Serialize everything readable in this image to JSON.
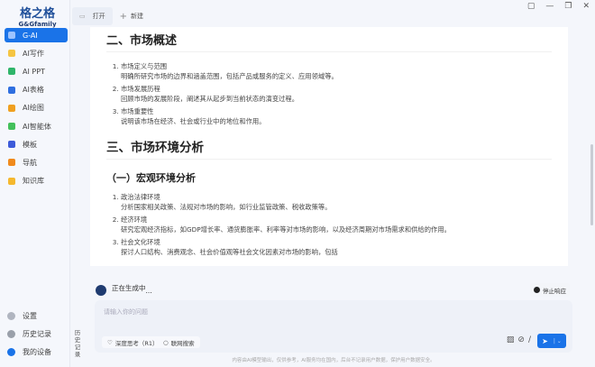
{
  "logo": {
    "cn": "格之格",
    "en": "G&Gfamily"
  },
  "sidebar": {
    "items": [
      {
        "label": "G-AI",
        "color": "#ffffff",
        "active": true
      },
      {
        "label": "AI写作",
        "color": "#f5c542"
      },
      {
        "label": "AI PPT",
        "color": "#2fb56a"
      },
      {
        "label": "AI表格",
        "color": "#2f6fe0"
      },
      {
        "label": "AI绘图",
        "color": "#f0a020"
      },
      {
        "label": "AI智能体",
        "color": "#43c05b"
      },
      {
        "label": "模板",
        "color": "#3d5bd9"
      },
      {
        "label": "导航",
        "color": "#f08a1c"
      },
      {
        "label": "知识库",
        "color": "#f5b82e"
      }
    ],
    "bottom": [
      {
        "label": "设置",
        "color": "#b0b5c0"
      },
      {
        "label": "历史记录",
        "color": "#9aa0aa"
      },
      {
        "label": "我的设备",
        "color": "#1a73e8"
      }
    ]
  },
  "tabs": {
    "open": "打开",
    "new": "新建"
  },
  "window": {
    "icons": [
      "feedback-icon",
      "minimize-icon",
      "restore-icon",
      "close-icon"
    ]
  },
  "content": {
    "h_market": "二、市场概述",
    "market_items": [
      {
        "title": "市场定义与范围",
        "desc": "明确所研究市场的边界和涵盖范围，包括产品或服务的定义、应用领域等。"
      },
      {
        "title": "市场发展历程",
        "desc": "回顾市场的发展阶段，阐述其从起步到当前状态的演变过程。"
      },
      {
        "title": "市场重要性",
        "desc": "说明该市场在经济、社会或行业中的地位和作用。"
      }
    ],
    "h_env": "三、市场环境分析",
    "h_macro": "（一）宏观环境分析",
    "macro_items": [
      {
        "title": "政治法律环境",
        "desc": "分析国家相关政策、法规对市场的影响，如行业监管政策、税收政策等。"
      },
      {
        "title": "经济环境",
        "desc": "研究宏观经济指标，如GDP增长率、通货膨胀率、利率等对市场的影响，以及经济周期对市场需求和供给的作用。"
      },
      {
        "title": "社会文化环境",
        "desc": "探讨人口结构、消费观念、社会价值观等社会文化因素对市场的影响，包括"
      }
    ]
  },
  "status": {
    "generating": "正在生成中",
    "dots": "...",
    "stop": "停止响应"
  },
  "input": {
    "placeholder": "请输入你的问题",
    "deep": "深度思考（R1）",
    "search": "联网搜索"
  },
  "history_vertical": "历史记录",
  "footer": "内容由AI模型输出，仅供参考，AI服务均在国内，后台不记录用户数据，保护用户数据安全。"
}
